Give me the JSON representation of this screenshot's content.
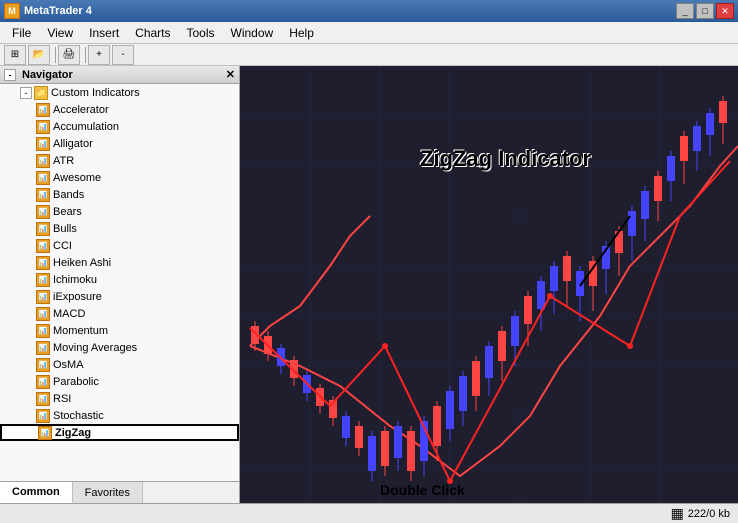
{
  "titleBar": {
    "title": "MetaTrader 4",
    "icon": "MT",
    "controls": [
      "minimize",
      "maximize",
      "close"
    ]
  },
  "menuBar": {
    "items": [
      "File",
      "View",
      "Insert",
      "Charts",
      "Tools",
      "Window",
      "Help"
    ]
  },
  "navigator": {
    "title": "Navigator",
    "sections": {
      "customIndicators": {
        "label": "Custom Indicators",
        "items": [
          "Accelerator",
          "Accumulation",
          "Alligator",
          "ATR",
          "Awesome",
          "Bands",
          "Bears",
          "Bulls",
          "CCI",
          "Heiken Ashi",
          "Ichimoku",
          "iExposure",
          "MACD",
          "Momentum",
          "Moving Averages",
          "OsMA",
          "Parabolic",
          "RSI",
          "Stochastic",
          "ZigZag"
        ]
      }
    },
    "tabs": [
      "Common",
      "Favorites"
    ]
  },
  "chart": {
    "annotation": "ZigZag Indicator",
    "doubleClickLabel": "Double Click",
    "backgroundColor": "#1a1a2e"
  },
  "statusBar": {
    "memory": "222/0 kb"
  }
}
